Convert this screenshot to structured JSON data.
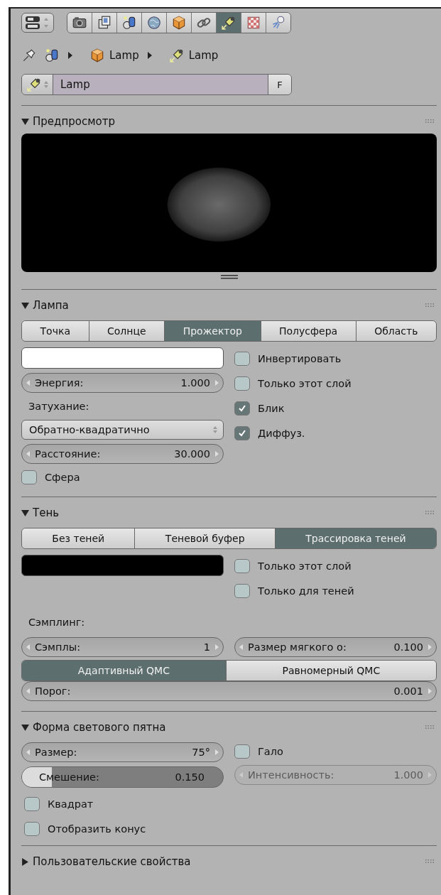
{
  "context_tabs": [
    {
      "kind": "camera",
      "selected": false
    },
    {
      "kind": "layers",
      "selected": false
    },
    {
      "kind": "scene",
      "selected": false
    },
    {
      "kind": "world",
      "selected": false
    },
    {
      "kind": "object",
      "selected": false
    },
    {
      "kind": "constraint",
      "selected": false
    },
    {
      "kind": "lamp",
      "selected": true
    },
    {
      "kind": "texture",
      "selected": false
    },
    {
      "kind": "particles",
      "selected": false
    }
  ],
  "breadcrumb": [
    {
      "kind": "object",
      "label": "Lamp"
    },
    {
      "kind": "lamp",
      "label": "Lamp"
    }
  ],
  "datablock": {
    "name": "Lamp",
    "fake_user": "F"
  },
  "preview": {
    "title": "Предпросмотр",
    "expanded": true
  },
  "lamp": {
    "title": "Лампа",
    "expanded": true,
    "types": [
      {
        "label": "Точка",
        "selected": false
      },
      {
        "label": "Солнце",
        "selected": false
      },
      {
        "label": "Прожектор",
        "selected": true
      },
      {
        "label": "Полусфера",
        "selected": false
      },
      {
        "label": "Область",
        "selected": false
      }
    ],
    "color": "#ffffff",
    "energy": {
      "label": "Энергия:",
      "value": "1.000"
    },
    "falloff_label": "Затухание:",
    "falloff": "Обратно-квадратично",
    "distance": {
      "label": "Расстояние:",
      "value": "30.000"
    },
    "sphere": {
      "label": "Сфера",
      "checked": false
    },
    "options": [
      {
        "label": "Инвертировать",
        "checked": false
      },
      {
        "label": "Только этот слой",
        "checked": false
      },
      {
        "label": "Блик",
        "checked": true
      },
      {
        "label": "Диффуз.",
        "checked": true
      }
    ]
  },
  "shadow": {
    "title": "Тень",
    "expanded": true,
    "methods": [
      {
        "label": "Без теней",
        "selected": false
      },
      {
        "label": "Теневой буфер",
        "selected": false
      },
      {
        "label": "Трассировка теней",
        "selected": true
      }
    ],
    "color": "#000000",
    "options": [
      {
        "label": "Только этот слой",
        "checked": false
      },
      {
        "label": "Только для теней",
        "checked": false
      }
    ],
    "sampling_label": "Сэмплинг:",
    "samples": {
      "label": "Сэмплы:",
      "value": "1"
    },
    "soft_size": {
      "label": "Размер мягкого о:",
      "value": "0.100"
    },
    "sampling_types": [
      {
        "label": "Адаптивный QMC",
        "selected": true
      },
      {
        "label": "Равномерный QMC",
        "selected": false
      }
    ],
    "threshold": {
      "label": "Порог:",
      "value": "0.001"
    }
  },
  "spot_shape": {
    "title": "Форма светового пятна",
    "expanded": true,
    "size": {
      "label": "Размер:",
      "value": "75°"
    },
    "halo": {
      "label": "Гало",
      "checked": false
    },
    "blend": {
      "label": "Смешение:",
      "value": "0.150",
      "level": 0.15
    },
    "intensity": {
      "label": "Интенсивность:",
      "value": "1.000",
      "disabled": true
    },
    "square": {
      "label": "Квадрат",
      "checked": false
    },
    "show_cone": {
      "label": "Отобразить конус",
      "checked": false
    }
  },
  "custom_properties": {
    "title": "Пользовательские свойства",
    "expanded": false
  }
}
